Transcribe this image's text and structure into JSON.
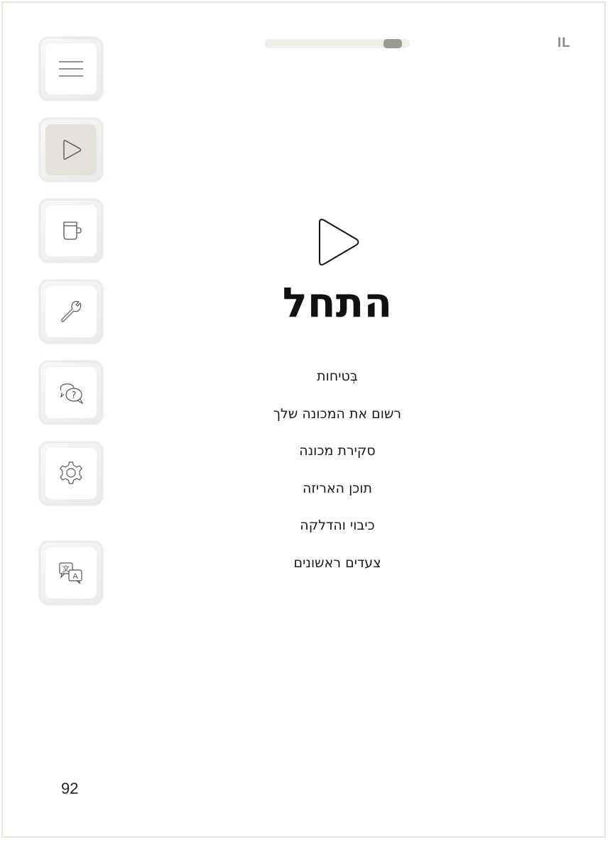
{
  "header": {
    "language": "IL",
    "progress_fraction": 0.94
  },
  "sidebar": {
    "items": [
      {
        "name": "menu",
        "icon": "hamburger-icon",
        "active": false
      },
      {
        "name": "start",
        "icon": "play-icon",
        "active": true
      },
      {
        "name": "cup",
        "icon": "cup-icon",
        "active": false
      },
      {
        "name": "maintenance",
        "icon": "wrench-icon",
        "active": false
      },
      {
        "name": "help",
        "icon": "help-chat-icon",
        "active": false
      },
      {
        "name": "settings",
        "icon": "gear-icon",
        "active": false
      },
      {
        "name": "language",
        "icon": "translate-icon",
        "active": false
      }
    ]
  },
  "main": {
    "icon": "play-icon",
    "title": "התחל",
    "items": [
      "בְּטיחות",
      "רשום את המכונה שלך",
      "סקירת מכונה",
      "תוכן האריזה",
      "כיבוי והדלקה",
      "צעדים ראשונים"
    ]
  },
  "footer": {
    "page_number": "92"
  },
  "colors": {
    "frame": "#e6e6d8",
    "active_button": "#e4e1dc",
    "progress_track": "#efeee8",
    "progress_knob": "#9a9a92"
  }
}
